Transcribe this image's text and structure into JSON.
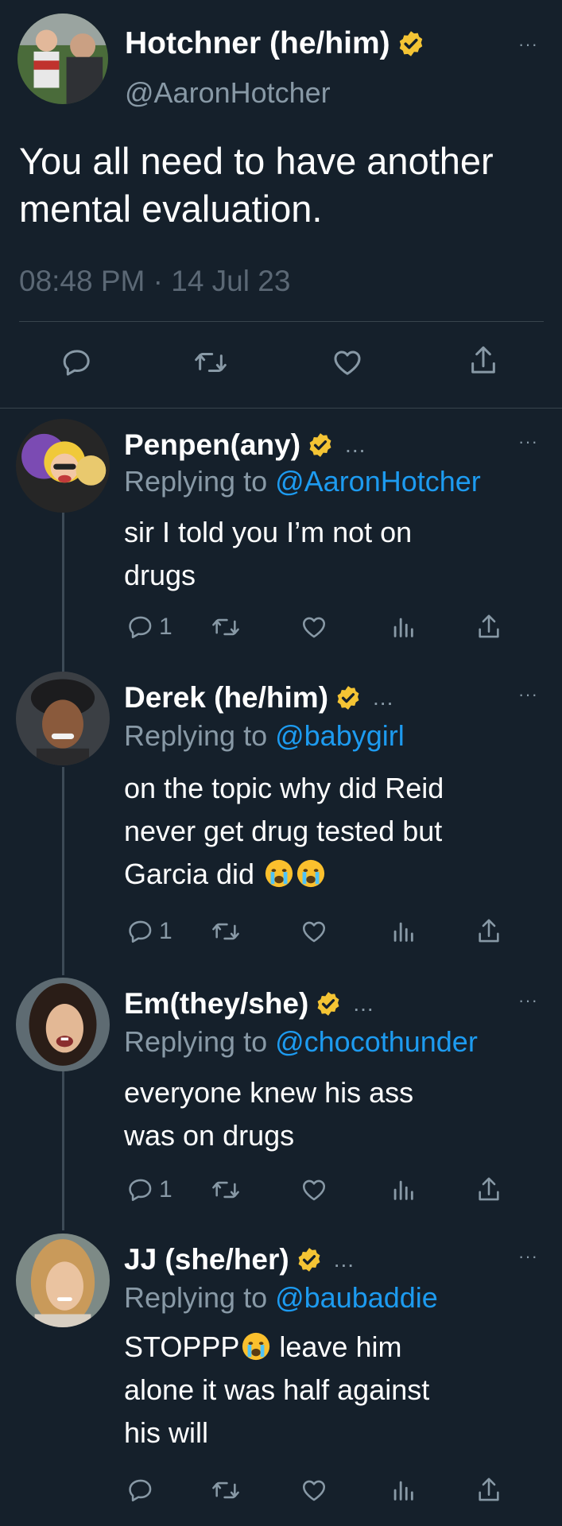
{
  "main": {
    "name": "Hotchner (he/him)",
    "handle": "@AaronHotcher",
    "text": "You all need to have another mental evaluation.",
    "timestamp": "08:48 PM · 14 Jul 23",
    "more_label": "···"
  },
  "replies": [
    {
      "name": "Penpen(any)",
      "ellipsis": "...",
      "replying_prefix": "Replying to ",
      "replying_to": "@AaronHotcher",
      "text_lines": [
        "sir I told you I’m not on",
        "drugs"
      ],
      "reply_count": "1"
    },
    {
      "name": "Derek (he/him)",
      "ellipsis": "...",
      "replying_prefix": "Replying to ",
      "replying_to": "@babygirl",
      "text_lines": [
        "on the topic why did Reid",
        "never get drug tested but",
        "Garcia did"
      ],
      "reply_count": "1"
    },
    {
      "name": "Em(they/she)",
      "ellipsis": "...",
      "replying_prefix": "Replying to ",
      "replying_to": "@chocothunder",
      "text_lines": [
        "everyone knew his ass",
        "was on drugs"
      ],
      "reply_count": "1"
    },
    {
      "name": "JJ (she/her)",
      "ellipsis": "...",
      "replying_prefix": "Replying to ",
      "replying_to": "@baubaddie",
      "text_lines": [
        "STOPPP",
        " leave him",
        "alone it was half against",
        "his will"
      ],
      "reply_count": ""
    }
  ],
  "colors": {
    "background": "#15202b",
    "secondary_text": "#8899a6",
    "mention": "#1d9bf0",
    "badge": "#f4c434",
    "divider": "#38444d"
  },
  "icons": [
    "reply-icon",
    "retweet-icon",
    "like-icon",
    "views-icon",
    "share-icon",
    "verified-badge-icon",
    "crying-emoji"
  ]
}
